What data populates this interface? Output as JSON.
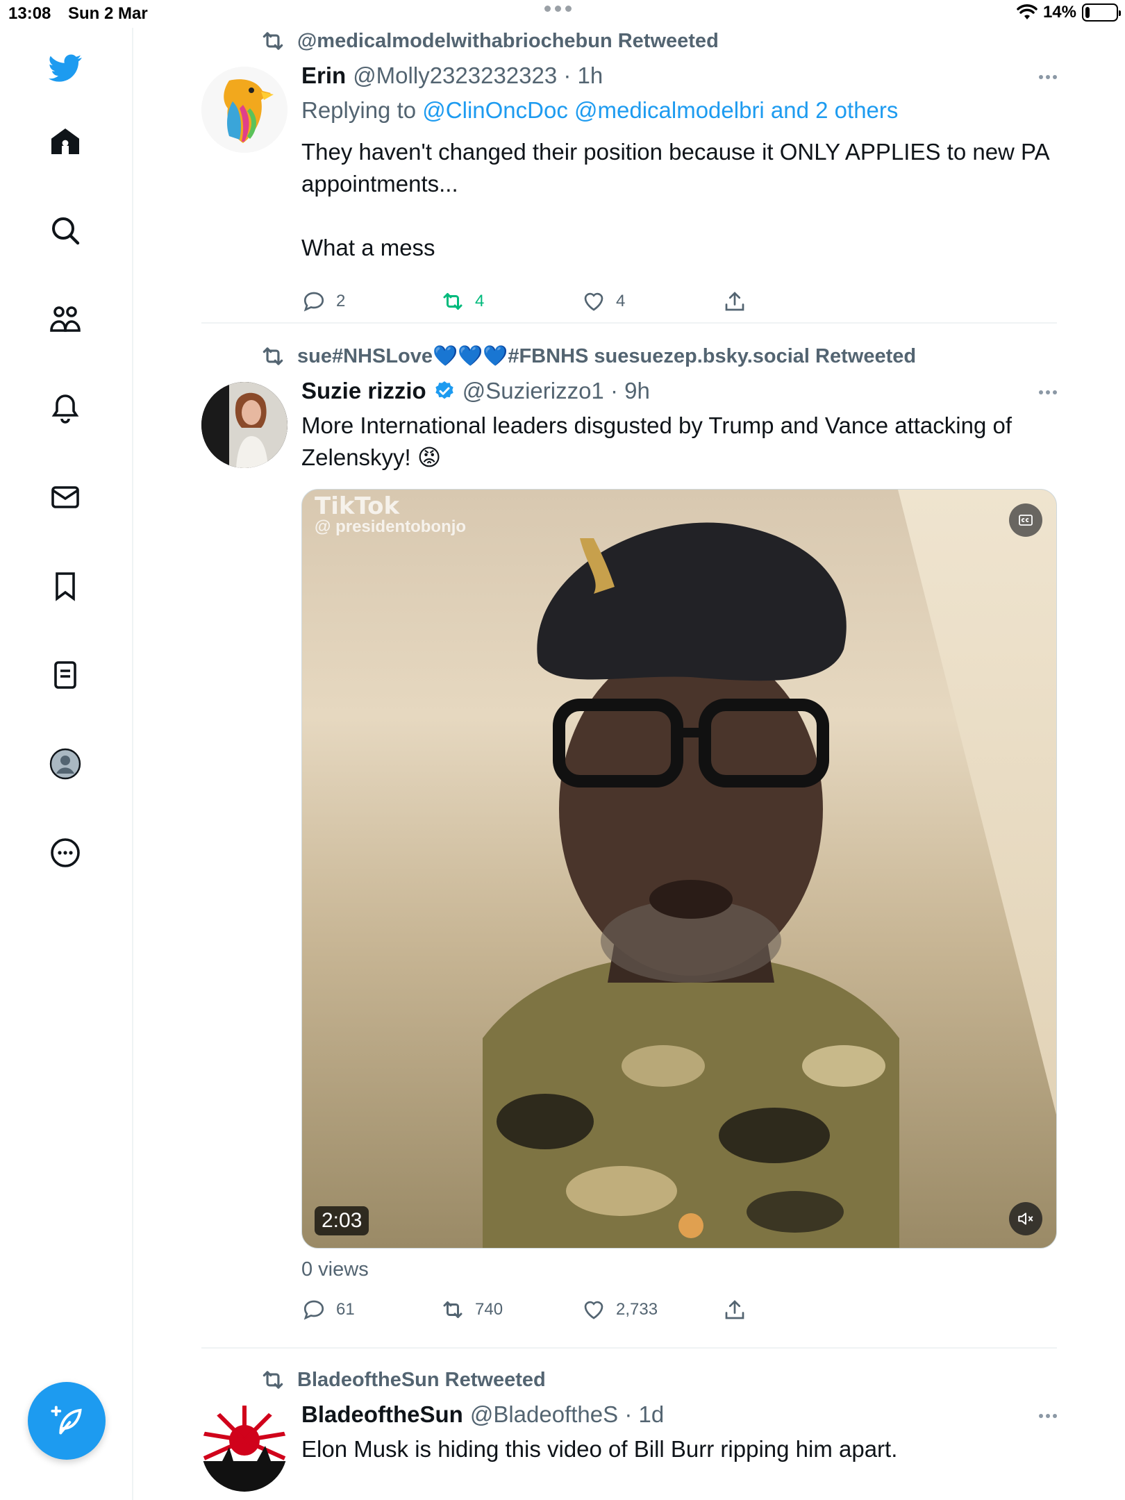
{
  "status_bar": {
    "time": "13:08",
    "date": "Sun 2 Mar",
    "battery_percent": "14%",
    "battery_level": 0.14
  },
  "sidebar": {
    "items": [
      {
        "icon": "twitter-bird-icon"
      },
      {
        "icon": "home-icon"
      },
      {
        "icon": "search-icon"
      },
      {
        "icon": "communities-icon"
      },
      {
        "icon": "notifications-bell-icon"
      },
      {
        "icon": "messages-envelope-icon"
      },
      {
        "icon": "bookmark-icon"
      },
      {
        "icon": "lists-icon"
      },
      {
        "icon": "profile-avatar-icon"
      },
      {
        "icon": "more-circle-icon"
      }
    ],
    "compose_icon": "compose-feather-icon"
  },
  "tweets": [
    {
      "retweeted_by": "@medicalmodelwithabriochebun Retweeted",
      "name": "Erin",
      "handle_time": "@Molly2323232323 · 1h",
      "replying_prefix": "Replying to",
      "replying_to": "@ClinOncDoc @medicalmodelbri and 2 others",
      "text": "They haven't changed their position because it ONLY APPLIES to new PA appointments...\n\nWhat a mess",
      "replies": "2",
      "retweets": "4",
      "likes": "4"
    },
    {
      "retweeted_by": "sue#NHSLove💙💙💙#FBNHS suesuezep.bsky.social Retweeted",
      "name": "Suzie rizzio",
      "verified": true,
      "handle_time": "@Suzierizzo1 · 9h",
      "text": "More International leaders disgusted by Trump and Vance attacking of Zelenskyy! 😡",
      "video": {
        "watermark_title": "TikTok",
        "watermark_handle": "@ presidentobonjo",
        "duration": "2:03"
      },
      "views": "0 views",
      "replies": "61",
      "retweets": "740",
      "likes": "2,733"
    },
    {
      "retweeted_by": "BladeoftheSun Retweeted",
      "name": "BladeoftheSun",
      "handle_time": "@BladeoftheS · 1d",
      "text": "Elon Musk is hiding this video of Bill Burr ripping him apart."
    }
  ],
  "colors": {
    "accent": "#1d9bf0",
    "retweet_green": "#00ba7c",
    "secondary_text": "#536471"
  }
}
